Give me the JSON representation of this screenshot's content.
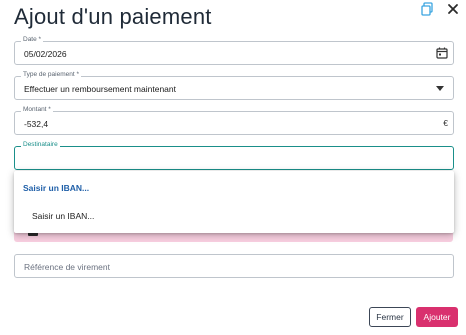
{
  "dialog": {
    "title": "Ajout d'un paiement",
    "copy_icon": "copy-icon",
    "close_icon": "close-icon"
  },
  "fields": {
    "date": {
      "label": "Date *",
      "value": "05/02/2026",
      "icon": "calendar-icon"
    },
    "type": {
      "label": "Type de paiement *",
      "value": "Effectuer un remboursement maintenant",
      "icon": "chevron-down-icon"
    },
    "amount": {
      "label": "Montant *",
      "value": "-532,4",
      "currency": "€"
    },
    "recipient": {
      "label": "Destinataire",
      "value": ""
    },
    "reference": {
      "placeholder": "Référence de virement"
    }
  },
  "dropdown": {
    "header": "Saisir un IBAN...",
    "items": [
      "Saisir un IBAN..."
    ]
  },
  "banner": {
    "color": "#f8cfe0"
  },
  "buttons": {
    "close_label": "Fermer",
    "add_label": "Ajouter"
  },
  "colors": {
    "accent": "#d9306e",
    "focus": "#1a8f8a",
    "link": "#1f5fa8"
  }
}
